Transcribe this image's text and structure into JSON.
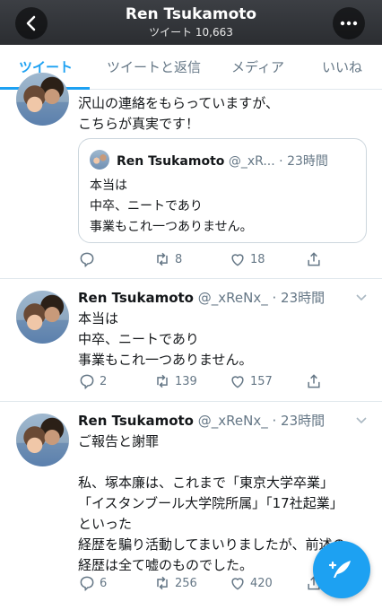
{
  "header": {
    "title": "Ren Tsukamoto",
    "subtitle": "ツイート 10,663"
  },
  "tabs": [
    {
      "label": "ツイート",
      "active": true
    },
    {
      "label": "ツイートと返信",
      "active": false
    },
    {
      "label": "メディア",
      "active": false
    },
    {
      "label": "いいね",
      "active": false
    }
  ],
  "tweets": [
    {
      "lines": [
        "沢山の連絡をもらっていますが、",
        "こちらが真実です！"
      ],
      "quote": {
        "name": "Ren Tsukamoto",
        "handle": " @_xR...",
        "time": " · 23時間",
        "lines": [
          "本当は",
          "中卒、ニートであり",
          "事業もこれ一つありません。"
        ]
      },
      "reply_count": "",
      "retweet_count": "8",
      "like_count": "18"
    },
    {
      "name": "Ren Tsukamoto",
      "handle": " @_xReNx_",
      "time": " · 23時間",
      "lines": [
        "本当は",
        "中卒、ニートであり",
        "事業もこれ一つありません。"
      ],
      "reply_count": "2",
      "retweet_count": "139",
      "like_count": "157"
    },
    {
      "name": "Ren Tsukamoto",
      "handle": " @_xReNx_",
      "time": " · 23時間",
      "lines": [
        "ご報告と謝罪",
        "",
        "私、塚本廉は、これまで「東京大学卒業」",
        "「イスタンブール大学院所属」「17社起業」",
        "といった",
        "経歴を騙り活動してまいりましたが、前述の",
        "経歴は全て嘘のものでした。"
      ],
      "reply_count": "6",
      "retweet_count": "256",
      "like_count": "420"
    }
  ],
  "colors": {
    "accent": "#1da1f2",
    "muted": "#657786",
    "text": "#14171a"
  },
  "icons": {
    "back": "back-arrow-icon",
    "more": "more-dots-icon",
    "compose": "compose-tweet-icon"
  }
}
